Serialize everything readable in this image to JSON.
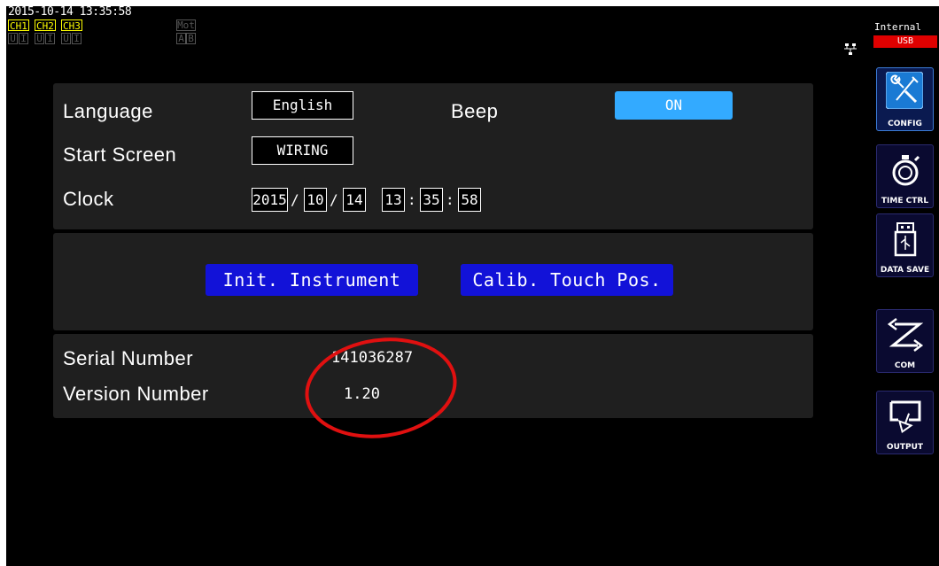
{
  "status": {
    "datetime": "2015-10-14 13:35:58",
    "channels": [
      "CH1",
      "CH2",
      "CH3"
    ],
    "ui_indicators": [
      "U",
      "I",
      "U",
      "I",
      "U",
      "I"
    ],
    "mot_label": "Mot",
    "ab": [
      "A",
      "B"
    ]
  },
  "sidebar": {
    "source_label": "Internal",
    "usb_label": "USB",
    "buttons": [
      {
        "label": "CONFIG",
        "icon": "wrench-screwdriver-icon"
      },
      {
        "label": "TIME CTRL",
        "icon": "stopwatch-icon"
      },
      {
        "label": "DATA SAVE",
        "icon": "usb-drive-icon"
      },
      {
        "label": "COM",
        "icon": "communication-arrows-icon"
      },
      {
        "label": "OUTPUT",
        "icon": "output-icon"
      }
    ]
  },
  "settings": {
    "language_label": "Language",
    "language_value": "English",
    "beep_label": "Beep",
    "beep_value": "ON",
    "start_screen_label": "Start Screen",
    "start_screen_value": "WIRING",
    "clock_label": "Clock",
    "clock": {
      "year": "2015",
      "month": "10",
      "day": "14",
      "hour": "13",
      "minute": "35",
      "second": "58",
      "date_sep": "/",
      "time_sep": ":"
    }
  },
  "actions": {
    "init_label": "Init. Instrument",
    "calib_label": "Calib. Touch Pos."
  },
  "info": {
    "serial_label": "Serial Number",
    "serial_value": "141036287",
    "version_label": "Version Number",
    "version_value": "1.20"
  },
  "colors": {
    "accent_on": "#33aaff",
    "action_button": "#1212d8",
    "channel": "#ffff00",
    "usb_badge": "#e00000",
    "annotation": "#e01010"
  }
}
